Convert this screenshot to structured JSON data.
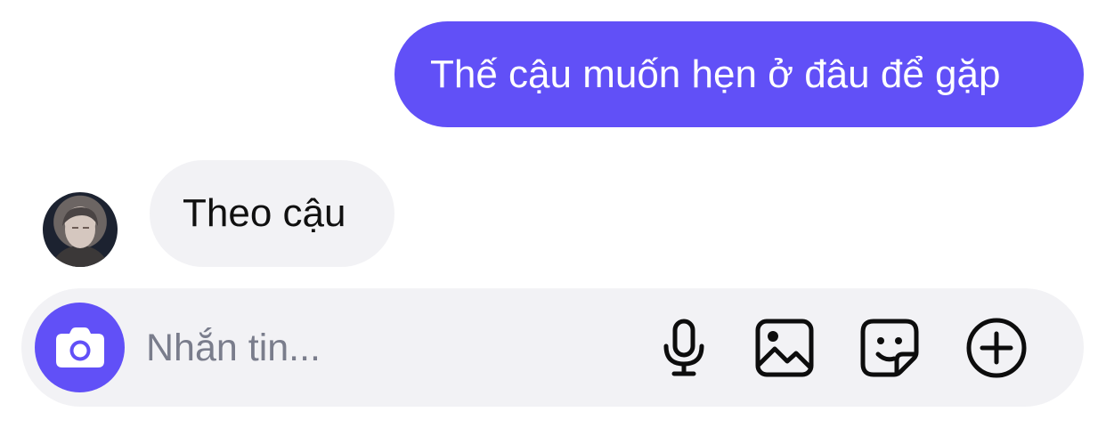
{
  "messages": {
    "outgoing": {
      "text": "Thế cậu muốn hẹn ở đâu để gặp"
    },
    "incoming": {
      "text": "Theo cậu",
      "avatar_icon": "contact-photo"
    }
  },
  "composer": {
    "placeholder": "Nhắn tin...",
    "camera_icon": "camera-icon",
    "actions": [
      "microphone-icon",
      "gallery-icon",
      "sticker-icon",
      "plus-circle-icon"
    ]
  },
  "colors": {
    "accent": "#6150f7",
    "incoming_bubble": "#f2f2f5",
    "composer_bg": "#f2f2f5",
    "placeholder": "#7a7d8c"
  }
}
